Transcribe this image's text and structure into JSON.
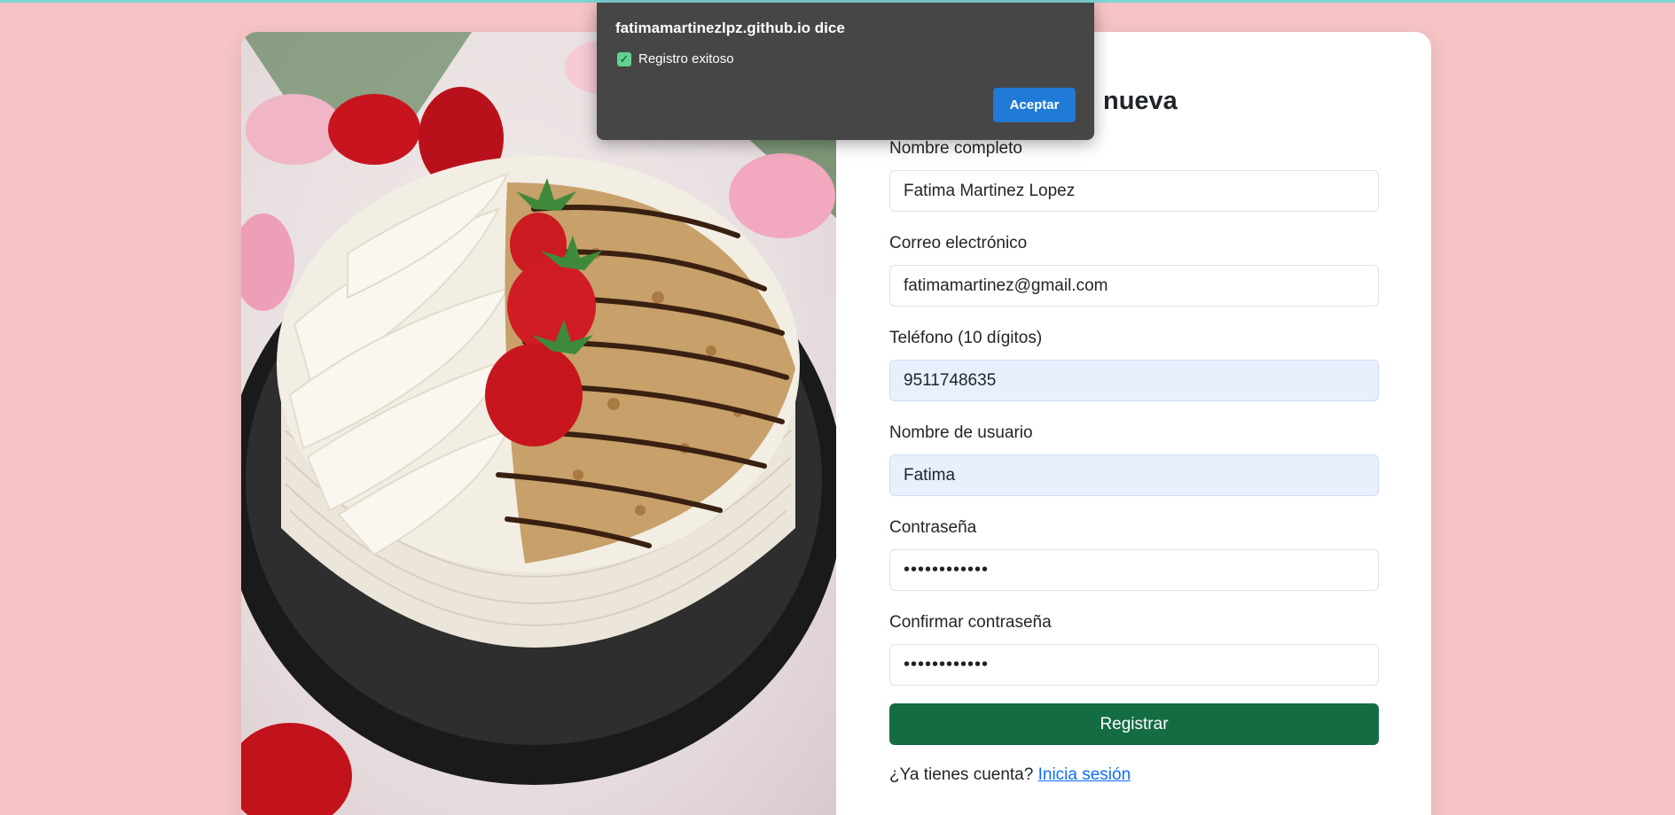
{
  "dialog": {
    "origin_title": "fatimamartinezlpz.github.io dice",
    "message": "Registro exitoso",
    "ok_label": "Aceptar"
  },
  "form": {
    "title": "nueva",
    "fields": [
      {
        "label": "Nombre completo",
        "value": "Fatima Martinez Lopez"
      },
      {
        "label": "Correo electrónico",
        "value": "fatimamartinez@gmail.com"
      },
      {
        "label": "Teléfono (10 dígitos)",
        "value": "9511748635"
      },
      {
        "label": "Nombre de usuario",
        "value": "Fatima"
      },
      {
        "label": "Contraseña",
        "value": "••••••••••••"
      },
      {
        "label": "Confirmar contraseña",
        "value": "••••••••••••"
      }
    ],
    "submit_label": "Registrar",
    "login_prompt": "¿Ya tienes cuenta?",
    "login_link": "Inicia sesión"
  },
  "colors": {
    "page_background": "#f6c4c4",
    "submit_button": "#146c43",
    "link": "#0d6efd",
    "dialog_button": "#1f7bd6"
  }
}
